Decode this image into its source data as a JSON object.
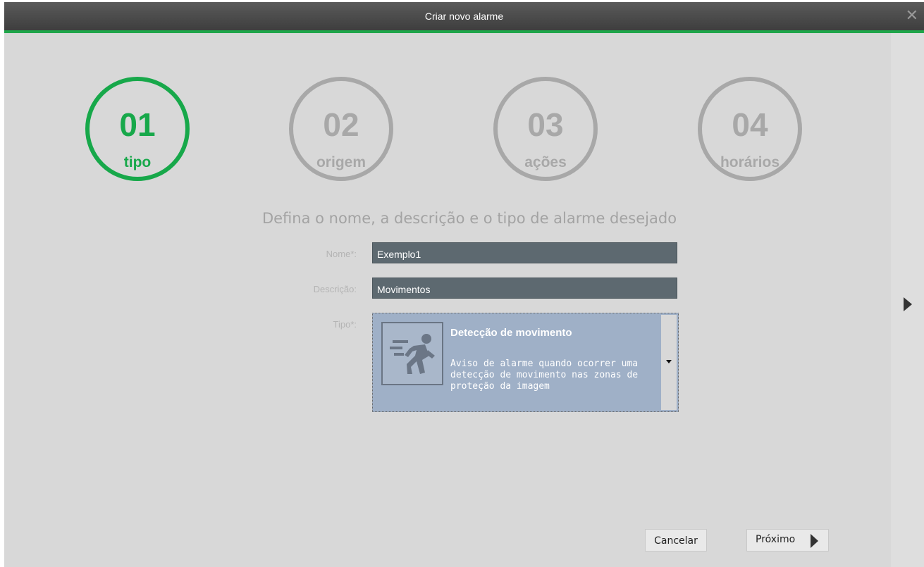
{
  "window": {
    "title": "Criar novo alarme",
    "close_glyph": "✕"
  },
  "steps": [
    {
      "number": "01",
      "label": "tipo",
      "active": true
    },
    {
      "number": "02",
      "label": "origem",
      "active": false
    },
    {
      "number": "03",
      "label": "ações",
      "active": false
    },
    {
      "number": "04",
      "label": "horários",
      "active": false
    }
  ],
  "subtitle": "Defina o nome, a descrição e o tipo de alarme desejado",
  "form": {
    "name_label": "Nome*:",
    "name_value": "Exemplo1",
    "description_label": "Descrição:",
    "description_value": "Movimentos",
    "type_label": "Tipo*:",
    "type_selected": {
      "title": "Detecção de movimento",
      "description": "Aviso de alarme quando ocorrer uma detecção de movimento nas zonas de proteção da imagem",
      "icon": "running-person-icon"
    }
  },
  "buttons": {
    "cancel": "Cancelar",
    "next": "Próximo"
  },
  "colors": {
    "active": "#17a84a",
    "inactive": "#a8a8a8",
    "field_bg": "#5d6970",
    "select_bg": "#9fb0c7"
  }
}
